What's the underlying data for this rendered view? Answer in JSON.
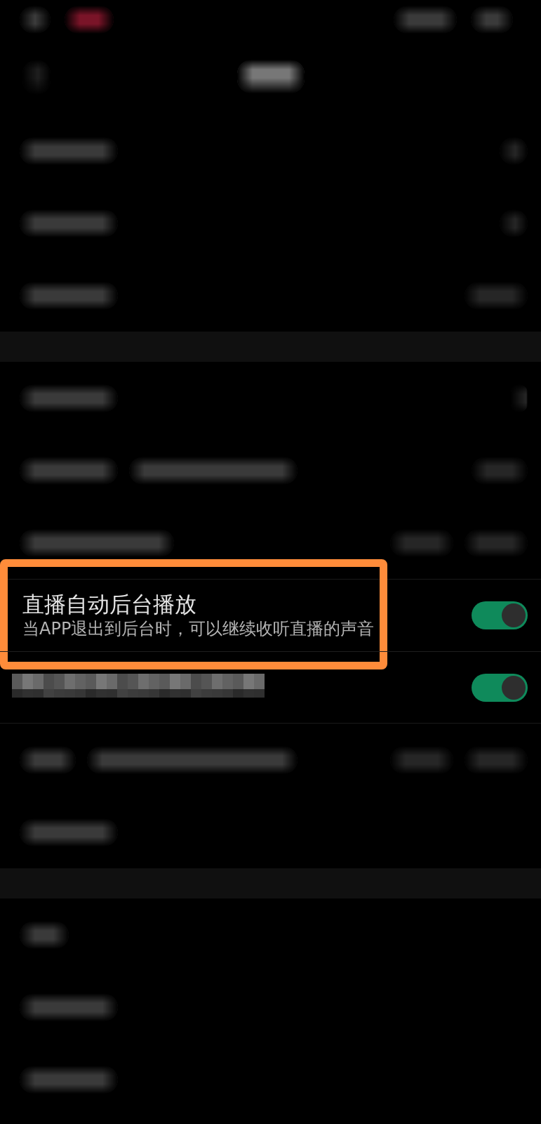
{
  "groups": [
    {
      "rows": [
        {
          "kind": "blurred"
        },
        {
          "kind": "blurred"
        },
        {
          "kind": "blurred"
        }
      ]
    },
    {
      "rows": [
        {
          "kind": "blurred"
        },
        {
          "kind": "blurred"
        },
        {
          "kind": "blurred"
        },
        {
          "kind": "toggle",
          "title": "直播自动后台播放",
          "subtitle": "当APP退出到后台时，可以继续收听直播的声音",
          "on": true,
          "highlighted": true
        },
        {
          "kind": "pixelated_toggle",
          "on": true,
          "highlighted": false
        },
        {
          "kind": "blurred"
        },
        {
          "kind": "blurred"
        }
      ]
    },
    {
      "rows": [
        {
          "kind": "blurred"
        },
        {
          "kind": "blurred"
        },
        {
          "kind": "blurred"
        }
      ]
    }
  ]
}
